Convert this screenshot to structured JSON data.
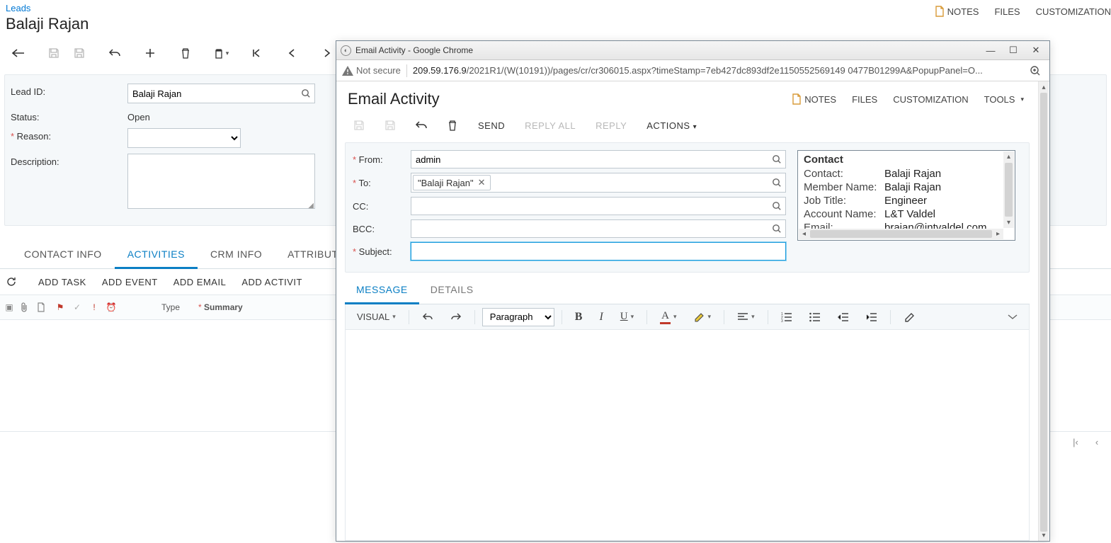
{
  "bg": {
    "leads_link": "Leads",
    "title": "Balaji Rajan",
    "top_right": {
      "notes": "NOTES",
      "files": "FILES",
      "customization": "CUSTOMIZATION"
    },
    "form": {
      "lead_id_label": "Lead ID:",
      "lead_id_value": "Balaji Rajan",
      "status_label": "Status:",
      "status_value": "Open",
      "reason_label": "Reason:",
      "description_label": "Description:"
    },
    "tabs": {
      "contact_info": "CONTACT INFO",
      "activities": "ACTIVITIES",
      "crm_info": "CRM INFO",
      "attributes": "ATTRIBUTES"
    },
    "cmds": {
      "add_task": "ADD TASK",
      "add_event": "ADD EVENT",
      "add_email": "ADD EMAIL",
      "add_activity": "ADD ACTIVIT"
    },
    "grid": {
      "type_col": "Type",
      "summary_col": "Summary"
    }
  },
  "popup": {
    "window_title": "Email Activity - Google Chrome",
    "not_secure": "Not secure",
    "url_dark": "209.59.176.9",
    "url_rest": "/2021R1/(W(10191))/pages/cr/cr306015.aspx?timeStamp=7eb427dc893df2e1150552569149 0477B01299A&PopupPanel=O...",
    "page_title": "Email Activity",
    "header_right": {
      "notes": "NOTES",
      "files": "FILES",
      "customization": "CUSTOMIZATION",
      "tools": "TOOLS"
    },
    "toolbar": {
      "send": "SEND",
      "reply_all": "REPLY ALL",
      "reply": "REPLY",
      "actions": "ACTIONS"
    },
    "form": {
      "from_label": "From:",
      "from_value": "admin",
      "to_label": "To:",
      "to_chip": "\"Balaji Rajan\"",
      "cc_label": "CC:",
      "bcc_label": "BCC:",
      "subject_label": "Subject:"
    },
    "contact": {
      "header": "Contact",
      "contact_label": "Contact:",
      "contact_value": "Balaji Rajan",
      "member_label": "Member Name:",
      "member_value": "Balaji Rajan",
      "job_label": "Job Title:",
      "job_value": "Engineer",
      "account_label": "Account Name:",
      "account_value": "L&T Valdel",
      "email_label": "Email:",
      "email_value": "brajan@intvaldel.com"
    },
    "tabs": {
      "message": "MESSAGE",
      "details": "DETAILS"
    },
    "editor": {
      "visual": "VISUAL",
      "paragraph": "Paragraph"
    }
  }
}
